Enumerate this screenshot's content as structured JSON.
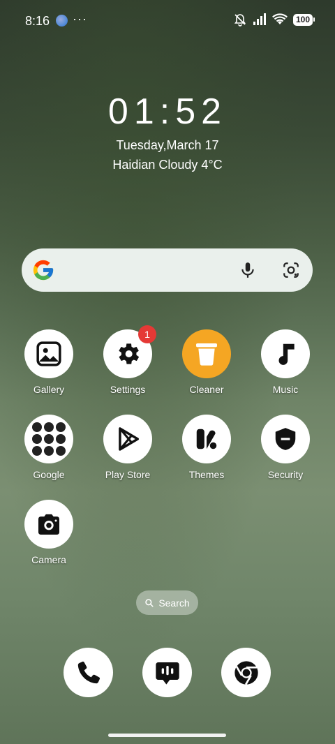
{
  "status_bar": {
    "time": "8:16",
    "dots": "···",
    "battery": "100"
  },
  "clock": {
    "time": "01:52",
    "date": "Tuesday,March 17",
    "weather": "Haidian Cloudy 4°C"
  },
  "search_widget": {
    "logo": "google-g-icon",
    "mic": "mic-icon",
    "lens": "lens-icon"
  },
  "apps": [
    {
      "label": "Gallery",
      "icon": "gallery-icon"
    },
    {
      "label": "Settings",
      "icon": "gear-icon",
      "badge": "1"
    },
    {
      "label": "Cleaner",
      "icon": "trash-icon"
    },
    {
      "label": "Music",
      "icon": "music-note-icon"
    },
    {
      "label": "Google",
      "icon": "folder-icon"
    },
    {
      "label": "Play Store",
      "icon": "play-store-icon"
    },
    {
      "label": "Themes",
      "icon": "themes-icon"
    },
    {
      "label": "Security",
      "icon": "shield-icon"
    },
    {
      "label": "Camera",
      "icon": "camera-icon"
    }
  ],
  "app_search": {
    "label": "Search"
  },
  "dock": [
    {
      "name": "phone",
      "icon": "phone-icon"
    },
    {
      "name": "messages",
      "icon": "message-icon"
    },
    {
      "name": "chrome",
      "icon": "chrome-icon"
    }
  ],
  "colors": {
    "badge": "#e53935",
    "cleaner": "#f5a623"
  }
}
